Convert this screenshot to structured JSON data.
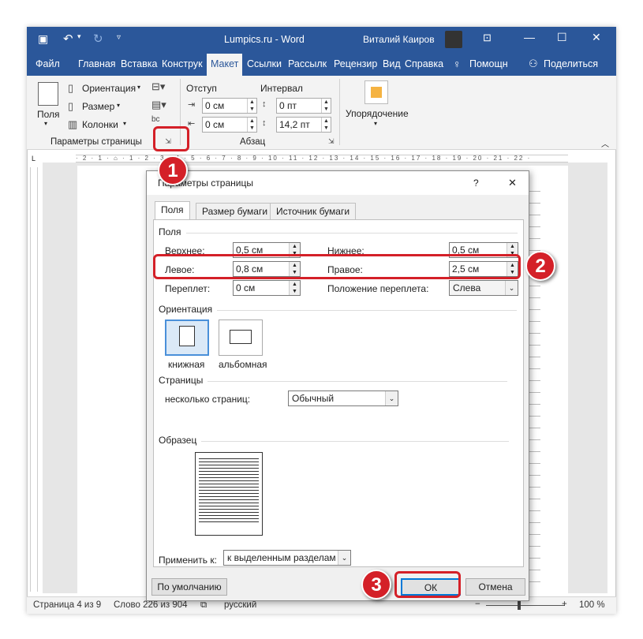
{
  "titlebar": {
    "title": "Lumpics.ru  -  Word",
    "user": "Виталий Каиров"
  },
  "tabs": [
    "Файл",
    "Главная",
    "Вставка",
    "Конструк",
    "Макет",
    "Ссылки",
    "Рассылк",
    "Рецензир",
    "Вид",
    "Справка"
  ],
  "tabs_right": {
    "tell": "Помощн",
    "share": "Поделиться"
  },
  "ribbon": {
    "margins": "Поля",
    "orientation": "Ориентация",
    "size": "Размер",
    "columns": "Колонки",
    "page_setup_group": "Параметры страницы",
    "indent": "Отступ",
    "spacing": "Интервал",
    "indent_left": "0 см",
    "indent_right": "0 см",
    "space_before": "0 пт",
    "space_after": "14,2 пт",
    "paragraph_group": "Абзац",
    "arrange": "Упорядочение"
  },
  "statusbar": {
    "page": "Страница 4 из 9",
    "words": "Слово 226 из 904",
    "lang": "русский",
    "zoom": "100 %"
  },
  "dialog": {
    "title": "Параметры страницы",
    "help": "?",
    "close": "✕",
    "tabs": [
      "Поля",
      "Размер бумаги",
      "Источник бумаги"
    ],
    "fields_section": "Поля",
    "top_label": "Верхнее:",
    "top_value": "0,5 см",
    "bottom_label": "Нижнее:",
    "bottom_value": "0,5 см",
    "left_label": "Левое:",
    "left_value": "0,8 см",
    "right_label": "Правое:",
    "right_value": "2,5 см",
    "gutter_label": "Переплет:",
    "gutter_value": "0 см",
    "gutter_pos_label": "Положение переплета:",
    "gutter_pos_value": "Слева",
    "orientation_section": "Ориентация",
    "portrait": "книжная",
    "landscape": "альбомная",
    "pages_section": "Страницы",
    "multiple_pages_label": "несколько страниц:",
    "multiple_pages_value": "Обычный",
    "preview_section": "Образец",
    "apply_label": "Применить к:",
    "apply_value": "к выделенным разделам",
    "default_btn": "По умолчанию",
    "ok_btn": "ОК",
    "cancel_btn": "Отмена"
  },
  "callouts": [
    "1",
    "2",
    "3"
  ],
  "colors": {
    "accent": "#2b579a",
    "callout": "#d42028"
  }
}
